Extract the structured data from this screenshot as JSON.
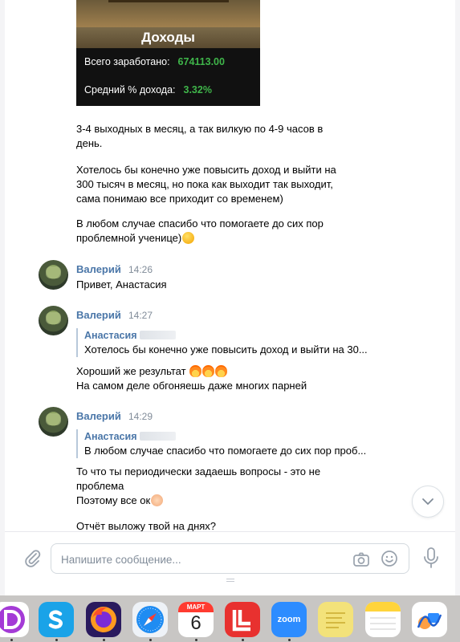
{
  "income_card": {
    "title": "Доходы",
    "total_label": "Всего заработано:",
    "total_value": "674113.00",
    "avg_label": "Средний % дохода:",
    "avg_value": "3.32%"
  },
  "previous_message": {
    "paragraph1_line1": "3-4 выходных в месяц, а так вилкую по 4-9 часов в",
    "paragraph1_line2": "день.",
    "paragraph2_line1": "Хотелось бы конечно уже повысить доход и выйти на",
    "paragraph2_line2": "300 тысяч в месяц, но пока как выходит так выходит,",
    "paragraph2_line3": "сама понимаю все приходит со временем)",
    "paragraph3_line1": "В любом случае спасибо что помогаете до сих пор",
    "paragraph3_line2": "проблемной ученице)",
    "paragraph3_emoji": "smiling-face"
  },
  "messages": [
    {
      "author": "Валерий",
      "time": "14:26",
      "lines": [
        "Привет, Анастасия"
      ]
    },
    {
      "author": "Валерий",
      "time": "14:27",
      "quote_name": "Анастасия",
      "quote_text": "Хотелось бы конечно уже повысить доход и выйти на 30...",
      "line1": "Хороший же результат",
      "line1_emoji": "fire",
      "line2": "На самом деле обгоняешь даже многих парней"
    },
    {
      "author": "Валерий",
      "time": "14:29",
      "quote_name": "Анастасия",
      "quote_text": "В любом случае спасибо что помогаете до сих пор проб...",
      "line1": "То что ты периодически задаешь вопросы - это не",
      "line2": "проблема",
      "line3": "Поэтому все ок",
      "line3_emoji": "raising-hands",
      "line4": "Отчёт выложу твой на днях?"
    }
  ],
  "composer": {
    "placeholder": "Напишите сообщение..."
  },
  "dock": {
    "calendar_month": "МАРТ",
    "calendar_day": "6",
    "zoom_label": "zoom",
    "icons": [
      "d-app-icon",
      "skype-icon",
      "firefox-icon",
      "safari-icon",
      "calendar-icon",
      "red-app-icon",
      "zoom-icon",
      "stickies-icon",
      "notes-icon",
      "freeform-icon"
    ]
  },
  "colors": {
    "author": "#4a76a8",
    "time": "#818c99",
    "income_green": "#3fb54a"
  }
}
